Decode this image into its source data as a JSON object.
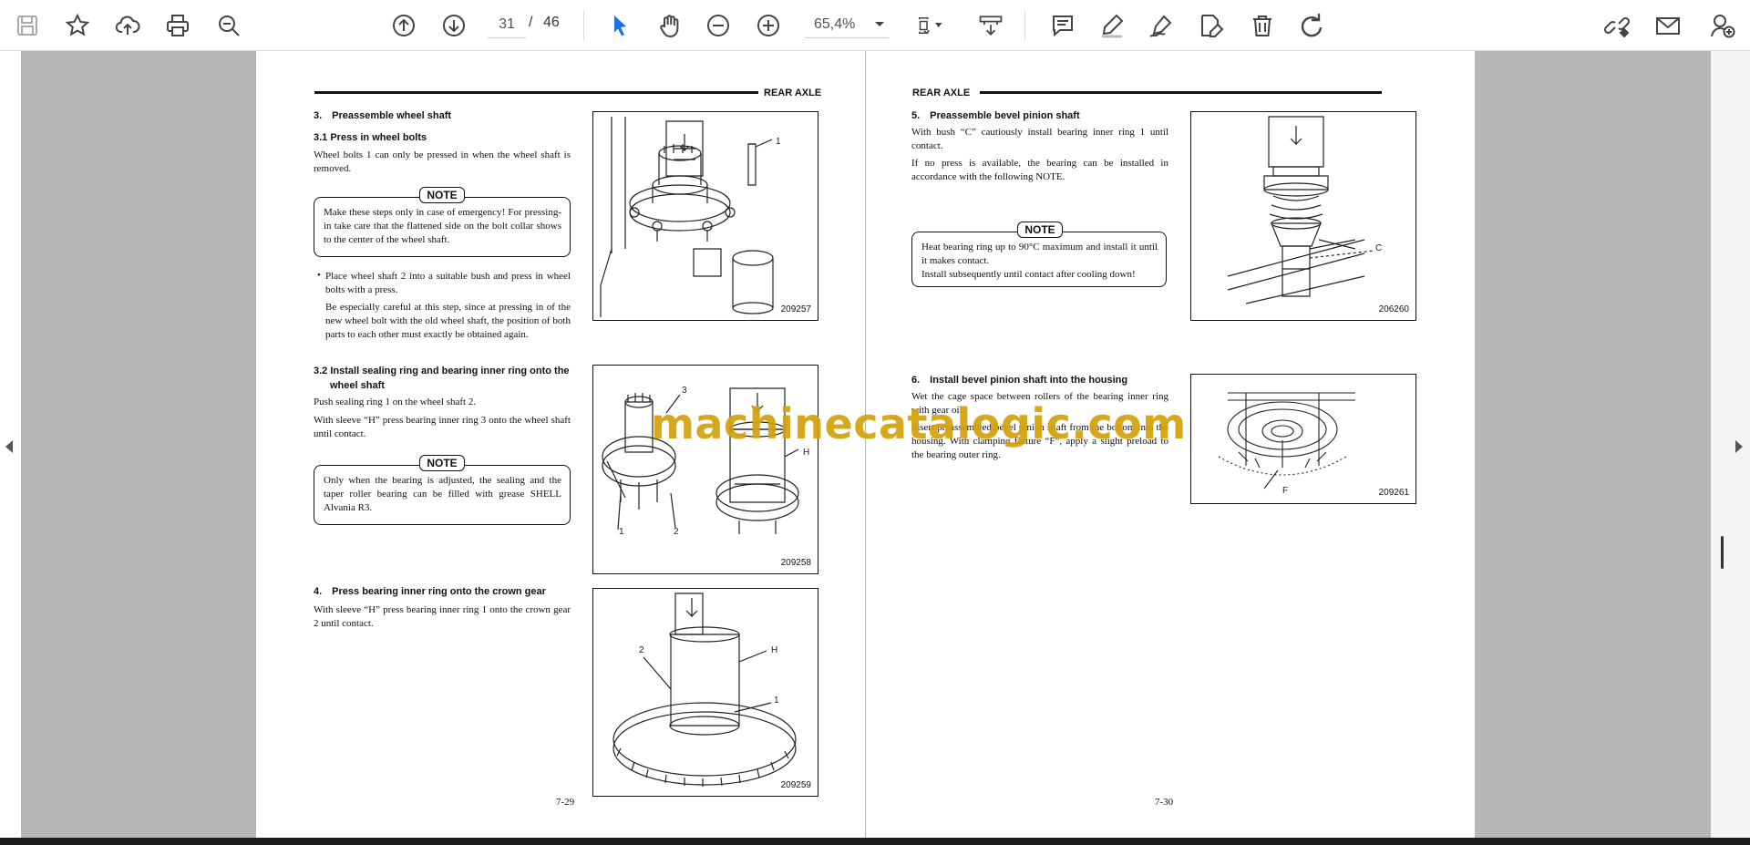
{
  "toolbar": {
    "page_current": "31",
    "page_separator": "/",
    "page_total": "46",
    "zoom_value": "65,4%"
  },
  "left_page": {
    "header": "REAR AXLE",
    "s3_title": "3. Preassemble wheel shaft",
    "s31_title": "3.1  Press in wheel bolts",
    "s31_text": "Wheel bolts 1 can only be pressed in when the wheel shaft is removed.",
    "note_label": "NOTE",
    "note1": "Make these steps only in case of emergency! For pressing-in take care that the flattened side on the bolt collar shows to the center of the wheel shaft.",
    "bullet_text": "Place wheel shaft 2 into a suitable bush and press in wheel bolts with a press.",
    "bullet_text2": "Be especially careful at this step, since at pressing in of the new wheel bolt with the old wheel shaft, the position of both parts to each other must exactly be obtained again.",
    "s32_title_1": "3.2  Install sealing ring and bearing inner ring onto the",
    "s32_title_2": "wheel shaft",
    "s32_text1": "Push sealing ring 1 on the wheel shaft 2.",
    "s32_text2": "With sleeve “H” press bearing inner ring 3 onto the wheel shaft until contact.",
    "note2": "Only when the bearing is adjusted, the sealing and the taper roller bearing can be filled with grease SHELL Alvania R3.",
    "s4_title": "4. Press bearing inner ring onto the crown gear",
    "s4_text": "With sleeve “H” press bearing inner ring 1 onto the crown gear 2 until contact.",
    "fig1_num": "209257",
    "fig2_num": "209258",
    "fig3_num": "209259",
    "page_number": "7-29"
  },
  "right_page": {
    "header": "REAR AXLE",
    "s5_title": "5. Preassemble bevel pinion shaft",
    "s5_text1": "With bush “C” cautiously install bearing inner ring 1 until contact.",
    "s5_text2": "If no press is available, the bearing can be installed in accordance with the following NOTE.",
    "note_label": "NOTE",
    "note3_line1": "Heat bearing ring up to 90°C maximum and install it until it makes contact.",
    "note3_line2": "Install subsequently until contact after cooling down!",
    "s6_title": "6. Install bevel pinion shaft into the housing",
    "s6_text1": "Wet the cage space between rollers of the bearing inner ring with gear oil.",
    "s6_text2": "Insert preassembled bevel pinion shaft from the bottom into the housing. With clamping fixture “F”, apply a slight preload to the bearing outer ring.",
    "fig4_num": "206260",
    "fig5_num": "209261",
    "page_number": "7-30"
  },
  "watermark": "machinecatalogic.com",
  "icons": [
    "save-icon",
    "bookmark-star-icon",
    "upload-cloud-icon",
    "print-icon",
    "zoom-search-icon",
    "page-up-icon",
    "page-down-icon",
    "select-arrow-icon",
    "hand-pan-icon",
    "zoom-out-icon",
    "zoom-in-icon",
    "chevron-down-icon",
    "page-fit-icon",
    "scroll-mode-icon",
    "comment-icon",
    "highlight-pen-icon",
    "sign-icon",
    "edit-pdf-icon",
    "trash-icon",
    "undo-rotate-icon",
    "share-link-icon",
    "mail-icon",
    "add-user-icon"
  ],
  "colors": {
    "accent_cursor": "#1a73e8",
    "viewer_gray": "#b7b7b7",
    "watermark": "#d4a20c"
  }
}
